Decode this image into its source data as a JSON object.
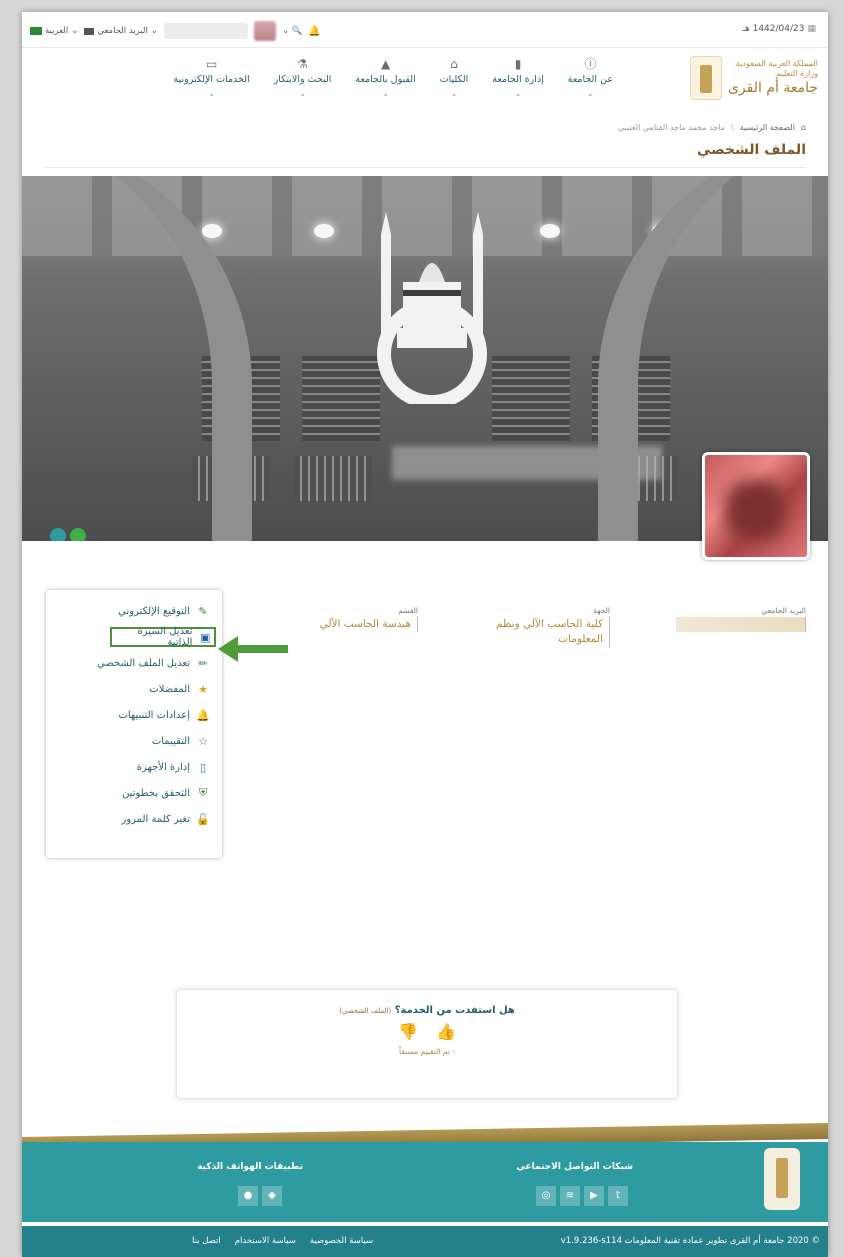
{
  "topbar": {
    "date": "1442/04/23 هـ",
    "language": "العربية",
    "university_mail": "البريد الجامعي"
  },
  "logo": {
    "line1": "المملكة العربية السعودية",
    "line2": "وزارة التعليم",
    "line3": "جامعة أم القرى"
  },
  "nav": [
    {
      "label": "عن الجامعة",
      "icon": "info-icon"
    },
    {
      "label": "إدارة الجامعة",
      "icon": "building-icon"
    },
    {
      "label": "الكليات",
      "icon": "institution-icon"
    },
    {
      "label": "القبول بالجامعة",
      "icon": "graduation-cap-icon"
    },
    {
      "label": "البحث والابتكار",
      "icon": "flask-icon"
    },
    {
      "label": "الخدمات الإلكترونية",
      "icon": "laptop-icon"
    }
  ],
  "breadcrumb": {
    "home": "الصفحة الرئيسية",
    "current": "ماجد محمد ماجد القتامي العتيبي"
  },
  "page_title": "الملف الشخصي",
  "profile": {
    "email_label": "البريد الجامعي",
    "college_label": "الجهة",
    "college_value": "كلية الحاسب الآلي ونظم المعلومات",
    "dept_label": "القسم",
    "dept_value": "هندسة الحاسب الآلي"
  },
  "menu": [
    {
      "label": "التوقيع الإلكتروني",
      "icon": "edit-icon",
      "color": "#3a8b2f"
    },
    {
      "label": "تعديل السيرة الذاتية",
      "icon": "id-card-icon",
      "color": "#1f5f9d"
    },
    {
      "label": "تعديل الملف الشخصي",
      "icon": "pencil-icon",
      "color": "#2d7c76"
    },
    {
      "label": "المفضلات",
      "icon": "star-icon",
      "color": "#e0a21a"
    },
    {
      "label": "إعدادات التنبيهات",
      "icon": "bell-icon",
      "color": "#1f6fa8"
    },
    {
      "label": "التقييمات",
      "icon": "star-outline-icon",
      "color": "#3a8b2f"
    },
    {
      "label": "إدارة الأجهزة",
      "icon": "mobile-icon",
      "color": "#1f6fa8"
    },
    {
      "label": "التحقق بخطوتين",
      "icon": "shield-check-icon",
      "color": "#3a8b2f"
    },
    {
      "label": "تغير كلمة المرور",
      "icon": "unlock-icon",
      "color": "#c62020"
    }
  ],
  "feedback": {
    "question": "هل استفدت من الخدمة؟",
    "service": "(الملف الشخصي)",
    "status": "- تم التقييم مسبقاً"
  },
  "footer": {
    "social_title": "شبكات التواصل الاجتماعي",
    "apps_title": "تطبيقات الهواتف الذكية",
    "copyright": "© 2020 جامعة أم القرى تطوير عمادة تقنية المعلومات v1.9.236-s114",
    "links": [
      "سياسة الخصوصية",
      "سياسة الاستخدام",
      "اتصل بنا"
    ]
  }
}
